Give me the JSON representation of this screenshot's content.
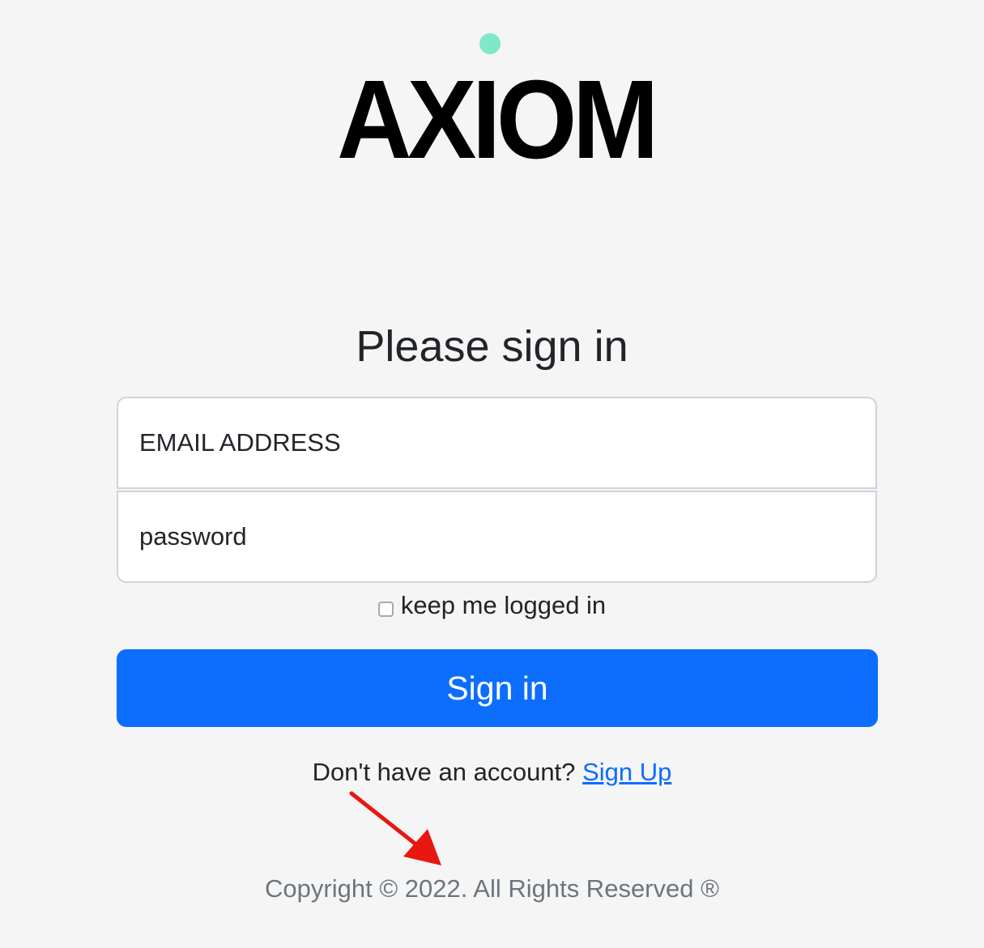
{
  "brand": {
    "name": "AXIOM",
    "dot_color": "#7ee8c8"
  },
  "form": {
    "title": "Please sign in",
    "email_placeholder": "EMAIL ADDRESS",
    "password_placeholder": "password",
    "remember_label": "keep me logged in",
    "remember_checked": false,
    "submit_label": "Sign in"
  },
  "signup": {
    "prompt": "Don't have an account?",
    "link_label": "Sign Up"
  },
  "footer": {
    "copyright": "Copyright © 2022. All Rights Reserved ®"
  },
  "colors": {
    "background": "#f5f5f5",
    "primary": "#0d6efd",
    "annotation_arrow": "#e8170f"
  },
  "annotation": {
    "icon": "red-arrow-icon"
  }
}
